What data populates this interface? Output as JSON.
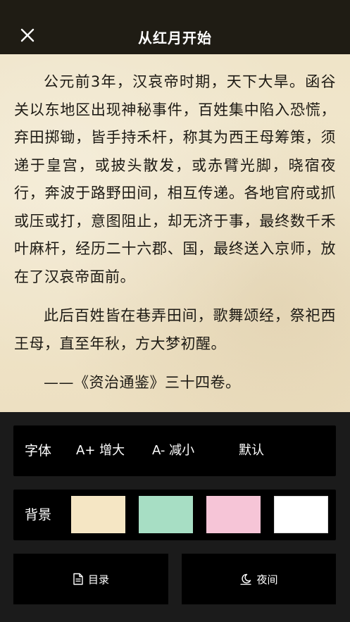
{
  "header": {
    "title": "从红月开始",
    "close_icon": "close-icon"
  },
  "reader": {
    "paragraphs": [
      "公元前3年，汉哀帝时期，天下大旱。函谷关以东地区出现神秘事件，百姓集中陷入恐慌，弃田掷锄，皆手持禾杆，称其为西王母筹策，须递于皇宫，或披头散发，或赤臂光脚，晓宿夜行，奔波于路野田间，相互传递。各地官府或抓或压或打，意图阻止，却无济于事，最终数千禾叶麻杆，经历二十六郡、国，最终送入京师，放在了汉哀帝面前。",
      "此后百姓皆在巷弄田间，歌舞颂经，祭祀西王母，直至年秋，方大梦初醒。",
      "——《资治通鉴》三十四卷。"
    ],
    "background_color": "#efe4c8"
  },
  "settings": {
    "font": {
      "label": "字体",
      "increase": "A+ 增大",
      "decrease": "A- 减小",
      "default": "默认"
    },
    "background": {
      "label": "背景",
      "swatches": [
        "#f5e6c4",
        "#a7dec4",
        "#f6c5d7",
        "#ffffff"
      ]
    },
    "toc_button": {
      "label": "目录",
      "icon": "document-icon"
    },
    "night_button": {
      "label": "夜间",
      "icon": "moon-icon"
    }
  }
}
